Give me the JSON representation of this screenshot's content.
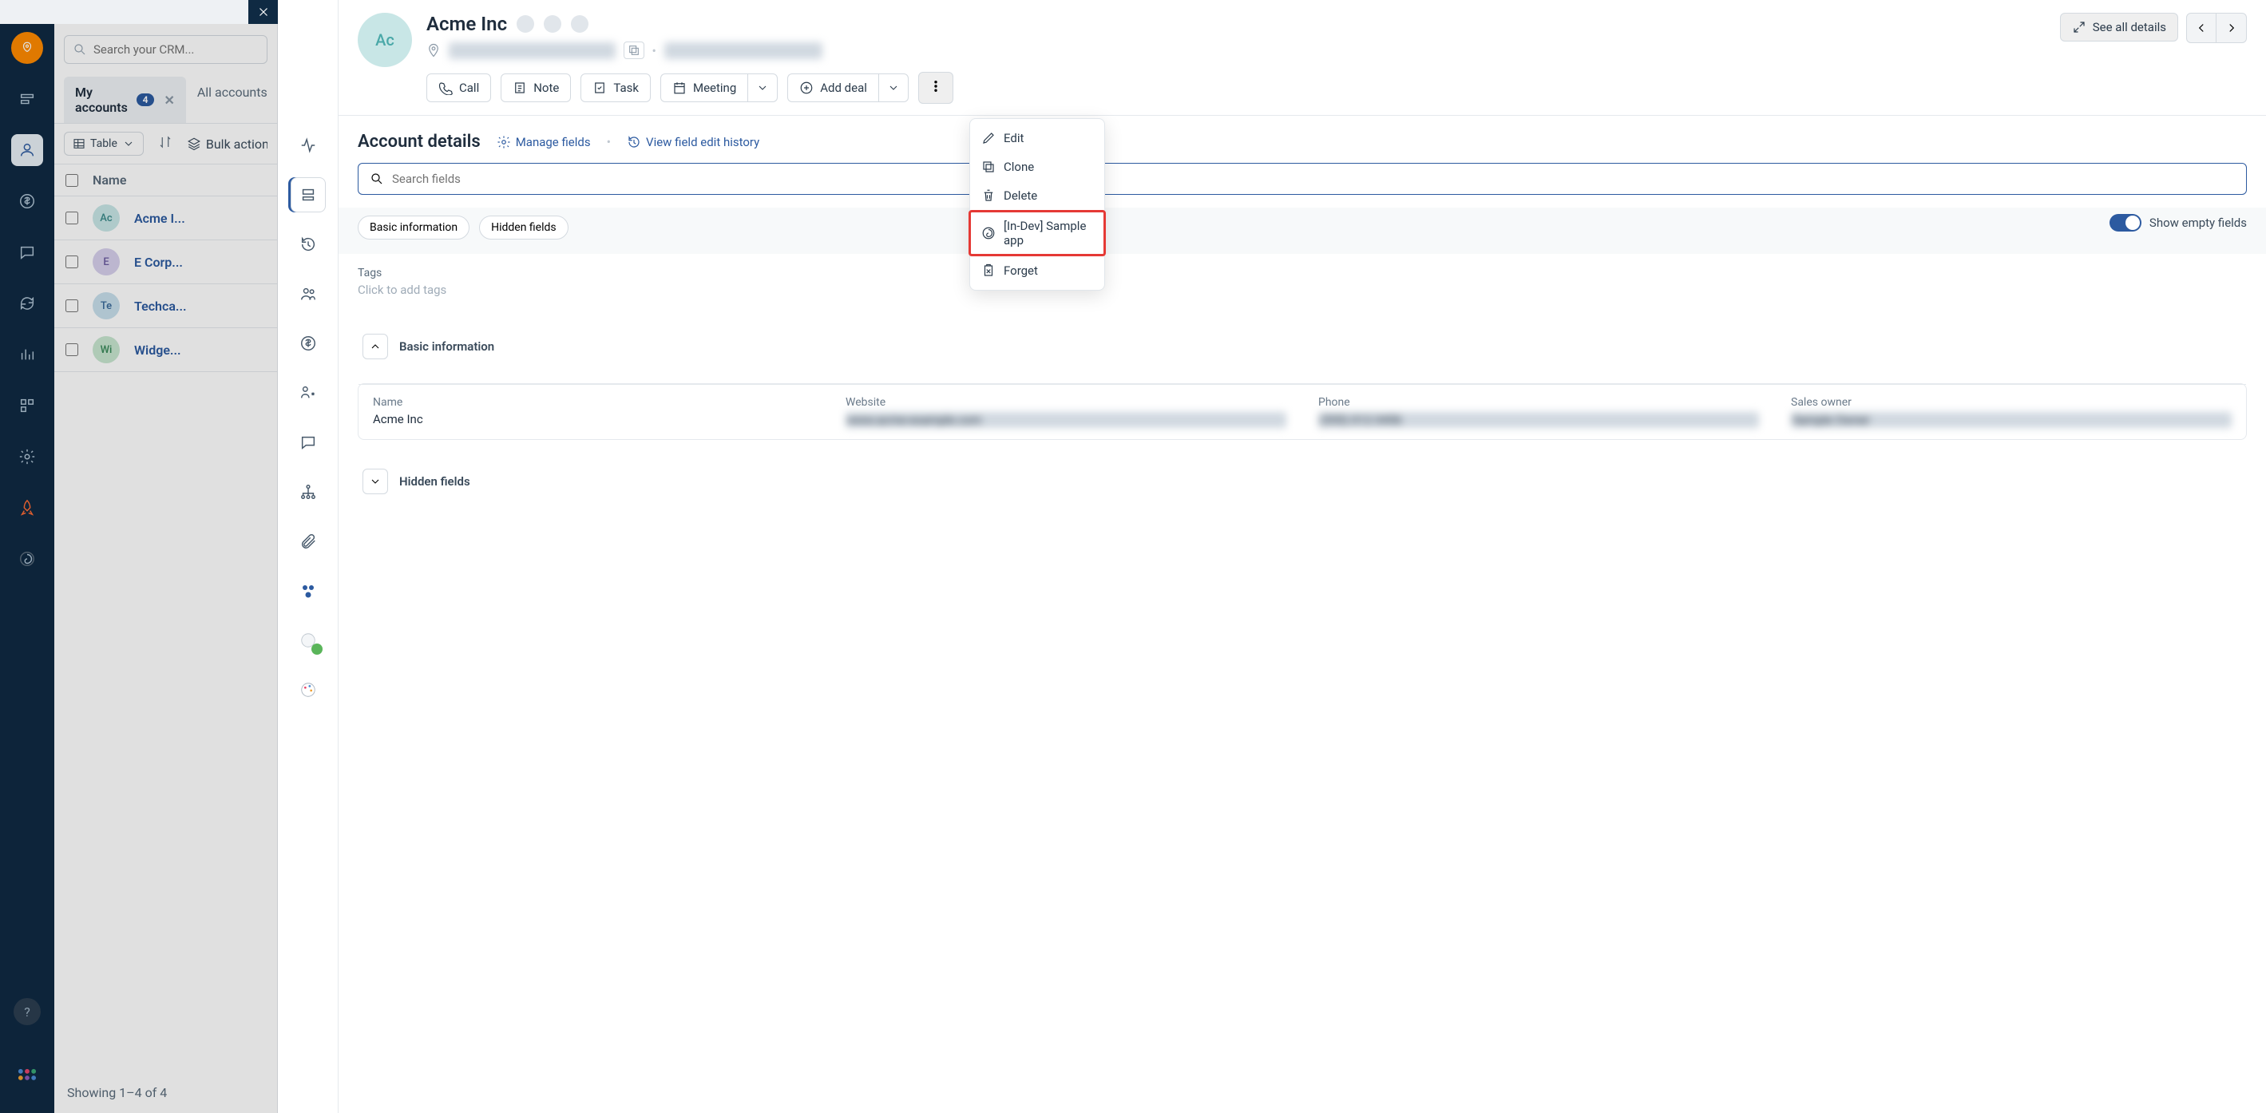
{
  "search": {
    "placeholder": "Search your CRM..."
  },
  "tabs": {
    "my": {
      "label": "My accounts",
      "count": "4"
    },
    "all": {
      "label": "All accounts"
    }
  },
  "table_btn": "Table",
  "bulk": "Bulk actions",
  "list": {
    "header": "Name",
    "rows": [
      {
        "initials": "Ac",
        "name": "Acme I..."
      },
      {
        "initials": "E",
        "name": "E Corp..."
      },
      {
        "initials": "Te",
        "name": "Techca..."
      },
      {
        "initials": "Wi",
        "name": "Widge..."
      }
    ],
    "footer": "Showing 1–4 of 4"
  },
  "account": {
    "initials": "Ac",
    "name": "Acme Inc",
    "address": "1234 Main Street, Suite 1234",
    "website": "www.example-domain.com",
    "see_all": "See all details"
  },
  "actions": {
    "call": "Call",
    "note": "Note",
    "task": "Task",
    "meeting": "Meeting",
    "add_deal": "Add deal"
  },
  "details": {
    "title": "Account details",
    "manage": "Manage fields",
    "history": "View field edit history",
    "search_placeholder": "Search fields",
    "show_empty": "Show empty fields",
    "chips": {
      "basic": "Basic information",
      "hidden": "Hidden fields"
    },
    "tags": {
      "label": "Tags",
      "placeholder": "Click to add tags"
    },
    "basic": {
      "title": "Basic information",
      "name_l": "Name",
      "name_v": "Acme Inc",
      "website_l": "Website",
      "website_v": "www.acme-example.com",
      "phone_l": "Phone",
      "phone_v": "(555) 012-3456",
      "owner_l": "Sales owner",
      "owner_v": "Sample Owner"
    },
    "hidden_title": "Hidden fields"
  },
  "menu": {
    "edit": "Edit",
    "clone": "Clone",
    "delete": "Delete",
    "sample": "[In-Dev] Sample app",
    "forget": "Forget"
  }
}
